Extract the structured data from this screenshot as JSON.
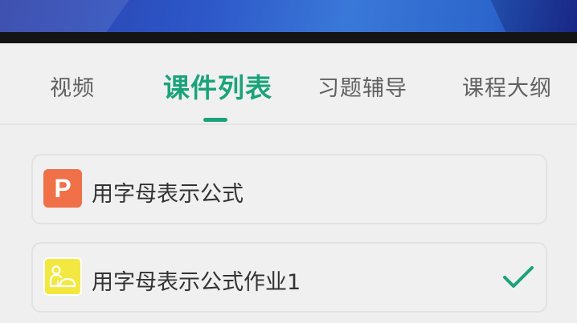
{
  "tabs": [
    {
      "label": "视频"
    },
    {
      "label": "课件列表"
    },
    {
      "label": "习题辅导"
    },
    {
      "label": "课程大纲"
    }
  ],
  "active_tab": "课件列表",
  "courseware": [
    {
      "title": "用字母表示公式",
      "icon_name": "ppt-file-icon",
      "icon_letter": "P",
      "icon_color": "#f07048",
      "completed": false
    },
    {
      "title": "用字母表示公式作业1",
      "icon_name": "homework-icon",
      "icon_color": "#f3e840",
      "completed": true
    }
  ],
  "colors": {
    "accent": "#1aa37a",
    "banner": "#2d57c8"
  }
}
